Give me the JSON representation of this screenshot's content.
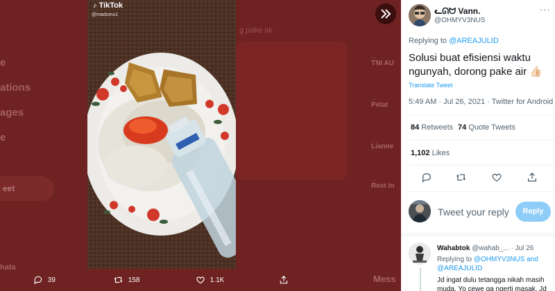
{
  "background": {
    "nav_items": [
      "e",
      "ations",
      "ages",
      "e"
    ],
    "tweet_button": "eet",
    "user_name": "hata",
    "center_text": "g pake air",
    "trends": [
      {
        "small": "...",
        "big": "TNI AU"
      },
      {
        "small": "...",
        "big": "Petat"
      },
      {
        "small": "...",
        "big": "Lianne"
      },
      {
        "small": "...",
        "big": "Rest in"
      }
    ],
    "messages_label": "Mess"
  },
  "media": {
    "app_logo": "TikTok",
    "username": "@madumu1",
    "actions": {
      "reply_count": "39",
      "retweet_count": "158",
      "like_count": "1.1K"
    }
  },
  "tweet": {
    "author_name": "ᓚᘏᗢ Vann.",
    "author_handle": "@OHMYV3NUS",
    "replying_label": "Replying to",
    "replying_to": "@AREAJULID",
    "text": "Solusi buat efisiensi waktu ngunyah, dorong pake air 👍🏻",
    "translate_label": "Translate Tweet",
    "time": "5:49 AM · Jul 26, 2021 · Twitter for Android",
    "retweets_count": "84",
    "retweets_label": "Retweets",
    "quotes_count": "74",
    "quotes_label": "Quote Tweets",
    "likes_count": "1,102",
    "likes_label": "Likes"
  },
  "compose": {
    "placeholder": "Tweet your reply",
    "button_label": "Reply"
  },
  "reply": {
    "name": "Wahabtok",
    "handle": "@wahab_...",
    "date": "· Jul 26",
    "replying_label": "Replying to",
    "replying_to_1": "@OHMYV3NUS",
    "replying_and": "and",
    "replying_to_2": "@AREAJULID",
    "text": "Jd ingat dulu tetangga nikah masih muda. Yo cewe ga ngerti masak. Jd"
  },
  "colors": {
    "accent": "#1d9bf0",
    "overlay": "#6e2222",
    "reply_button": "#8ecdf8"
  }
}
